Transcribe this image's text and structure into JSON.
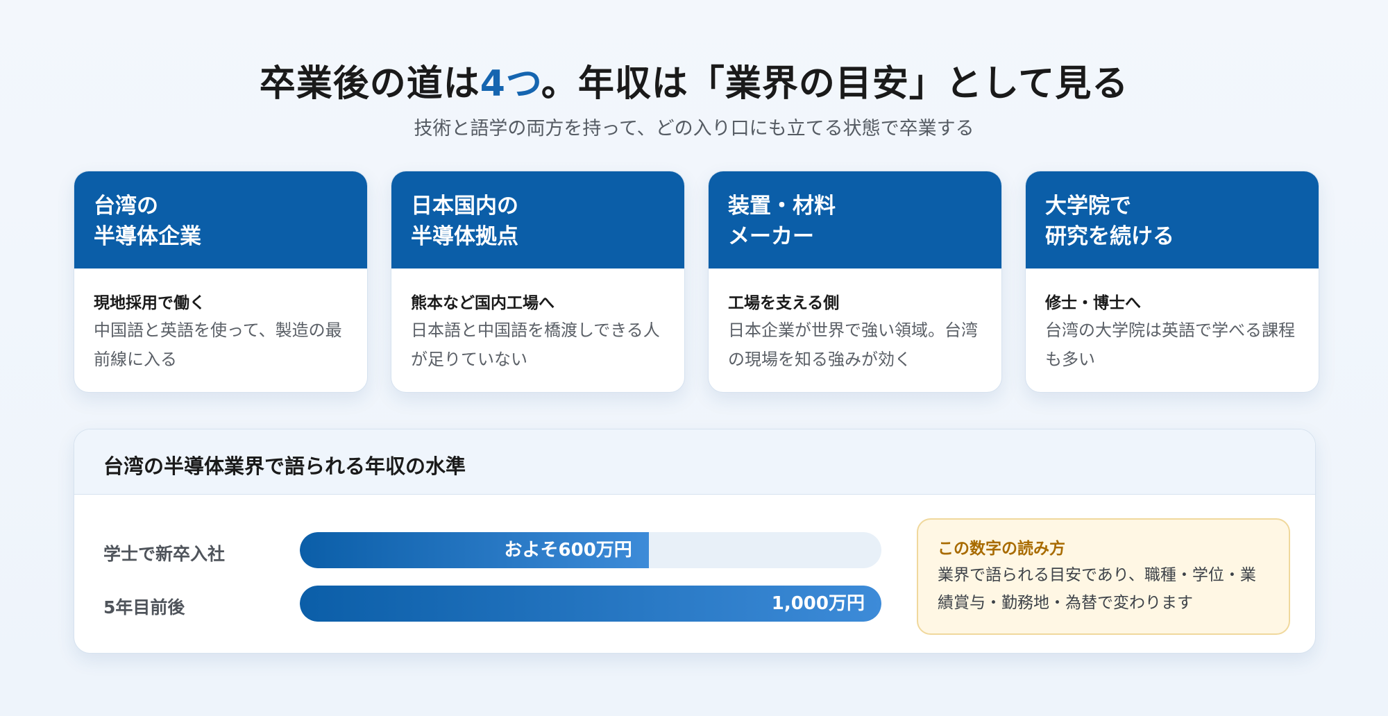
{
  "header": {
    "title_pre": "卒業後の道は",
    "title_accent": "4つ",
    "title_post": "。年収は「業界の目安」として見る",
    "subtitle": "技術と語学の両方を持って、どの入り口にも立てる状態で卒業する"
  },
  "cards": [
    {
      "title_line1": "台湾の",
      "title_line2": "半導体企業",
      "subtitle": "現地採用で働く",
      "desc": "中国語と英語を使って、製造の最前線に入る"
    },
    {
      "title_line1": "日本国内の",
      "title_line2": "半導体拠点",
      "subtitle": "熊本など国内工場へ",
      "desc": "日本語と中国語を橋渡しできる人が足りていない"
    },
    {
      "title_line1": "装置・材料",
      "title_line2": "メーカー",
      "subtitle": "工場を支える側",
      "desc": "日本企業が世界で強い領域。台湾の現場を知る強みが効く"
    },
    {
      "title_line1": "大学院で",
      "title_line2": "研究を続ける",
      "subtitle": "修士・博士へ",
      "desc": "台湾の大学院は英語で学べる課程も多い"
    }
  ],
  "salary": {
    "title": "台湾の半導体業界で語られる年収の水準",
    "rows": [
      {
        "label": "学士で新卒入社",
        "value_label": "およそ600万円",
        "fraction": 0.6
      },
      {
        "label": "5年目前後",
        "value_label": "1,000万円",
        "fraction": 1.0
      }
    ],
    "note": {
      "title": "この数字の読み方",
      "text": "業界で語られる目安であり、職種・学位・業績賞与・勤務地・為替で変わります"
    }
  },
  "colors": {
    "accent": "#1565b0",
    "card_header": "#0b5ea8",
    "note_bg": "#fff7e4",
    "note_title": "#a86b00"
  }
}
